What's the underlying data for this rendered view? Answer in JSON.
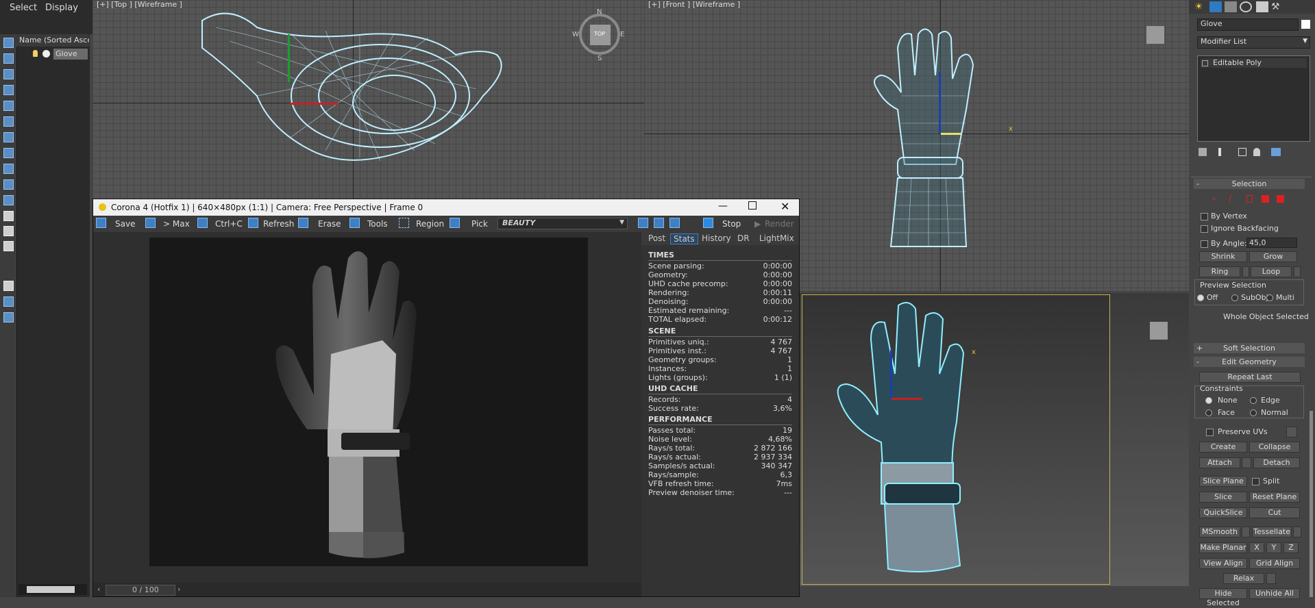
{
  "menu": {
    "select": "Select",
    "display": "Display"
  },
  "scene_explorer": {
    "header": "Name (Sorted Ascen",
    "item": "Glove",
    "scroll_label": "0 / 100"
  },
  "viewports": {
    "top_label": "[+] [Top ] [Wireframe ]",
    "front_label": "[+] [Front ] [Wireframe ]",
    "compass": {
      "n": "N",
      "s": "S",
      "e": "E",
      "w": "W",
      "top": "TOP"
    },
    "axis_x": "x"
  },
  "corona": {
    "title": "Corona 4 (Hotfix 1) | 640×480px (1:1) | Camera: Free Perspective | Frame 0",
    "toolbar": {
      "save": "Save",
      "max": "> Max",
      "copy": "Ctrl+C",
      "refresh": "Refresh",
      "erase": "Erase",
      "tools": "Tools",
      "region": "Region",
      "pick": "Pick",
      "beauty": "BEAUTY",
      "stop": "Stop",
      "render": "Render"
    },
    "tabs": [
      "Post",
      "Stats",
      "History",
      "DR",
      "LightMix"
    ],
    "stats": {
      "times_title": "TIMES",
      "times": [
        {
          "k": "Scene parsing:",
          "v": "0:00:00"
        },
        {
          "k": "Geometry:",
          "v": "0:00:00"
        },
        {
          "k": "UHD cache precomp:",
          "v": "0:00:00"
        },
        {
          "k": "Rendering:",
          "v": "0:00:11"
        },
        {
          "k": "Denoising:",
          "v": "0:00:00"
        },
        {
          "k": "Estimated remaining:",
          "v": "---"
        },
        {
          "k": "TOTAL elapsed:",
          "v": "0:00:12"
        }
      ],
      "scene_title": "SCENE",
      "scene": [
        {
          "k": "Primitives uniq.:",
          "v": "4 767"
        },
        {
          "k": "Primitives inst.:",
          "v": "4 767"
        },
        {
          "k": "Geometry groups:",
          "v": "1"
        },
        {
          "k": "Instances:",
          "v": "1"
        },
        {
          "k": "Lights (groups):",
          "v": "1 (1)"
        }
      ],
      "uhd_title": "UHD CACHE",
      "uhd": [
        {
          "k": "Records:",
          "v": "4"
        },
        {
          "k": "Success rate:",
          "v": "3,6%"
        }
      ],
      "perf_title": "PERFORMANCE",
      "perf": [
        {
          "k": "Passes total:",
          "v": "19"
        },
        {
          "k": "Noise level:",
          "v": "4,68%"
        },
        {
          "k": "Rays/s total:",
          "v": "2 872 166"
        },
        {
          "k": "Rays/s actual:",
          "v": "2 937 334"
        },
        {
          "k": "Samples/s actual:",
          "v": "340 347"
        },
        {
          "k": "Rays/sample:",
          "v": "6,3"
        },
        {
          "k": "VFB refresh time:",
          "v": "7ms"
        },
        {
          "k": "Preview denoiser time:",
          "v": "---"
        }
      ]
    }
  },
  "command_panel": {
    "object_name": "Glove",
    "modifier_list": "Modifier List",
    "stack_item": "Editable Poly",
    "selection": "Selection",
    "by_vertex": "By Vertex",
    "ignore_backfacing": "Ignore Backfacing",
    "by_angle": "By Angle:",
    "by_angle_value": "45,0",
    "shrink": "Shrink",
    "grow": "Grow",
    "ring": "Ring",
    "loop": "Loop",
    "preview_selection": "Preview Selection",
    "off": "Off",
    "subobj": "SubObj",
    "multi": "Multi",
    "whole_object": "Whole Object Selected",
    "soft_selection": "Soft Selection",
    "edit_geometry": "Edit Geometry",
    "repeat_last": "Repeat Last",
    "constraints": "Constraints",
    "none": "None",
    "edge": "Edge",
    "face": "Face",
    "normal": "Normal",
    "preserve_uvs": "Preserve UVs",
    "create": "Create",
    "collapse": "Collapse",
    "attach": "Attach",
    "detach": "Detach",
    "slice_plane": "Slice Plane",
    "split": "Split",
    "slice": "Slice",
    "reset_plane": "Reset Plane",
    "quickslice": "QuickSlice",
    "cut": "Cut",
    "msmooth": "MSmooth",
    "tessellate": "Tessellate",
    "make_planar": "Make Planar",
    "x": "X",
    "y": "Y",
    "z": "Z",
    "view_align": "View Align",
    "grid_align": "Grid Align",
    "relax": "Relax",
    "hide_selected": "Hide Selected",
    "unhide_all": "Unhide All"
  },
  "colors": {
    "accent": "#3f7fc4",
    "wire": "#bfefff",
    "active_border": "#c8b34a",
    "red_swatch": "#e02020"
  }
}
